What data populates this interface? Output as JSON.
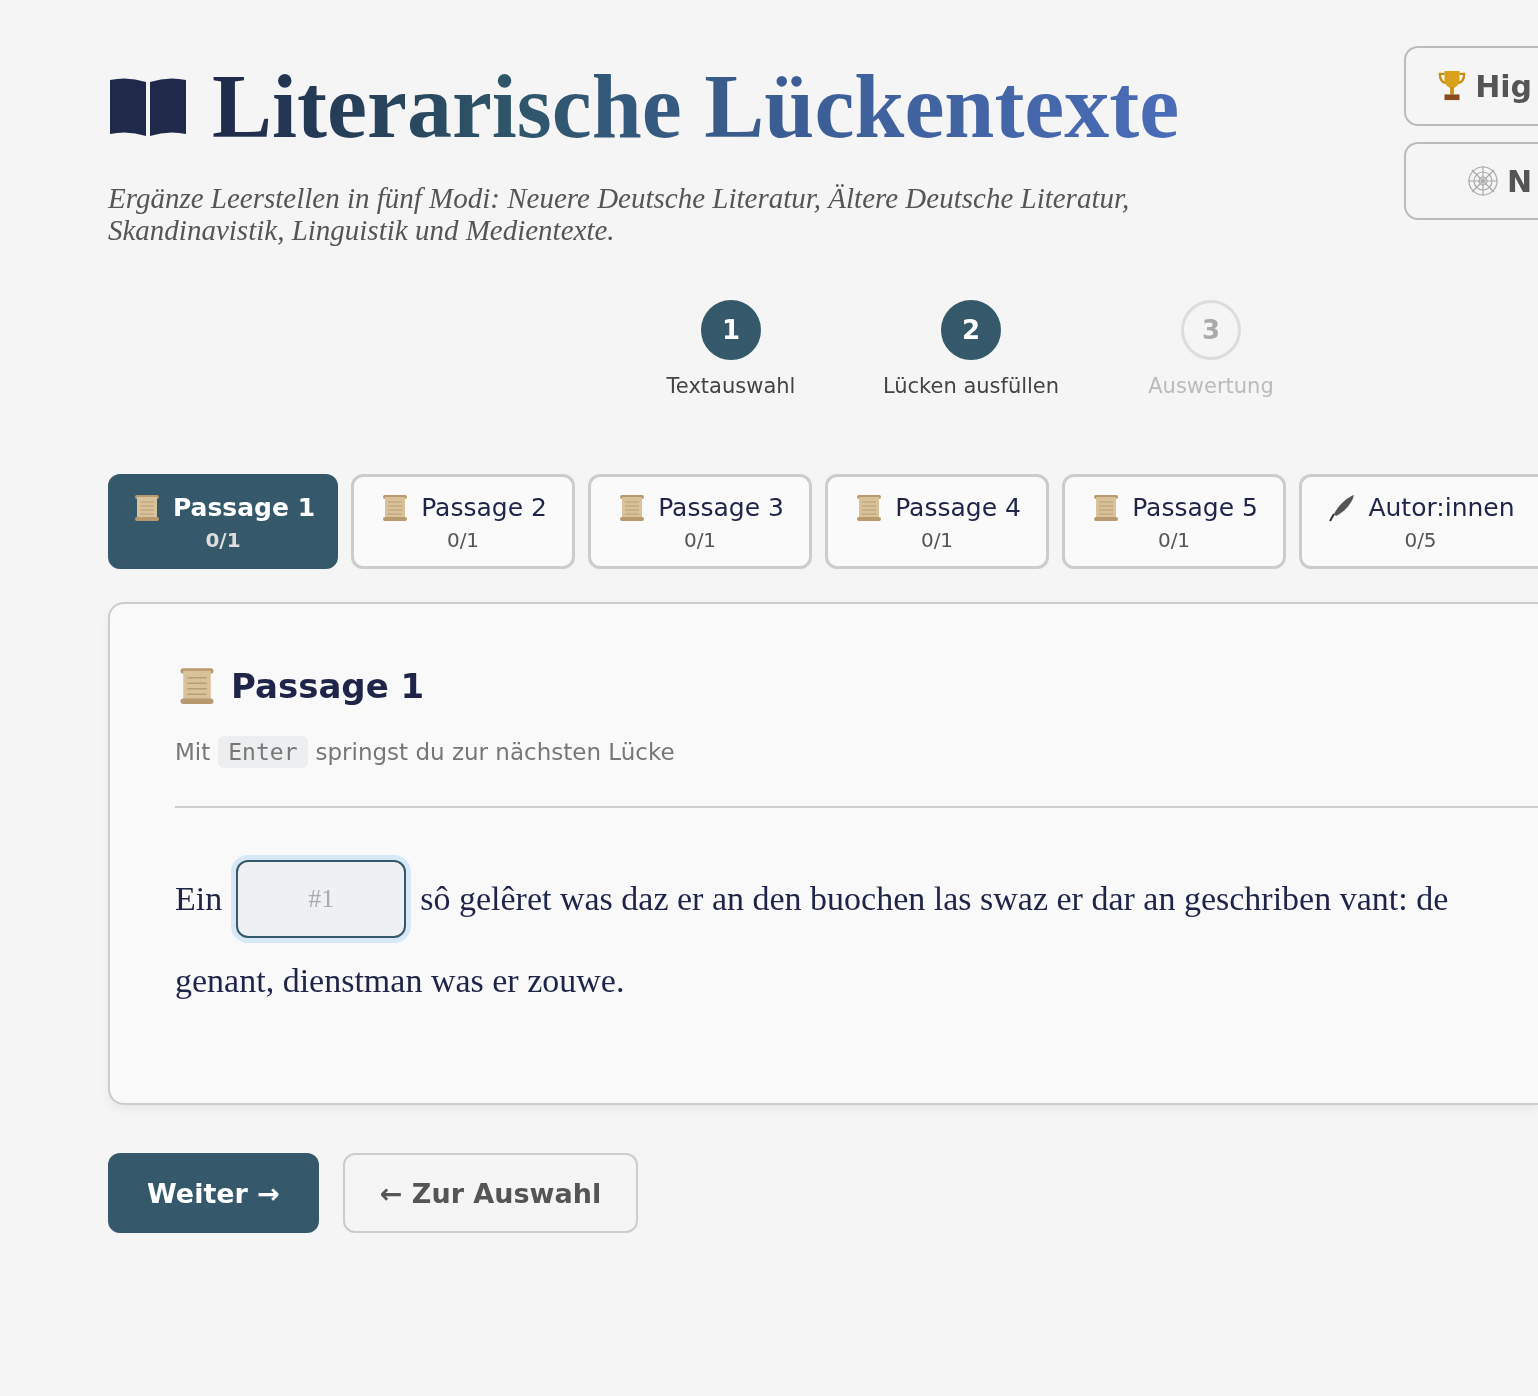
{
  "header": {
    "title": "Literarische Lückentexte",
    "subtitle": "Ergänze Leerstellen in fünf Modi: Neuere Deutsche Literatur, Ältere Deutsche Literatur, Skandinavistik, Linguistik und Medientexte.",
    "actions": [
      {
        "kind": "trophy",
        "label": "Hig"
      },
      {
        "kind": "web",
        "label": "N"
      }
    ]
  },
  "steps": [
    {
      "number": "1",
      "label": "Textauswahl",
      "active": true
    },
    {
      "number": "2",
      "label": "Lücken ausfüllen",
      "active": true
    },
    {
      "number": "3",
      "label": "Auswertung",
      "active": false
    }
  ],
  "tabs": [
    {
      "kind": "scroll",
      "label": "Passage 1",
      "progress": "0/1",
      "selected": true
    },
    {
      "kind": "scroll",
      "label": "Passage 2",
      "progress": "0/1",
      "selected": false
    },
    {
      "kind": "scroll",
      "label": "Passage 3",
      "progress": "0/1",
      "selected": false
    },
    {
      "kind": "scroll",
      "label": "Passage 4",
      "progress": "0/1",
      "selected": false
    },
    {
      "kind": "scroll",
      "label": "Passage 5",
      "progress": "0/1",
      "selected": false
    },
    {
      "kind": "quill",
      "label": "Autor:innen",
      "progress": "0/5",
      "selected": false
    }
  ],
  "card": {
    "title": "Passage 1",
    "hint_before": "Mit",
    "hint_key": "Enter",
    "hint_after": "springst du zur nächsten Lücke",
    "text_before": "Ein",
    "gap": {
      "placeholder": "#1"
    },
    "text_after": "sô gelêret was daz er an den buochen las swaz er dar an geschriben vant: de",
    "text_line_2": "genant, dienstman was er zouwe."
  },
  "buttons": [
    {
      "kind": "primary",
      "label": "Weiter →"
    },
    {
      "kind": "secondary",
      "label": "← Zur Auswahl"
    }
  ]
}
